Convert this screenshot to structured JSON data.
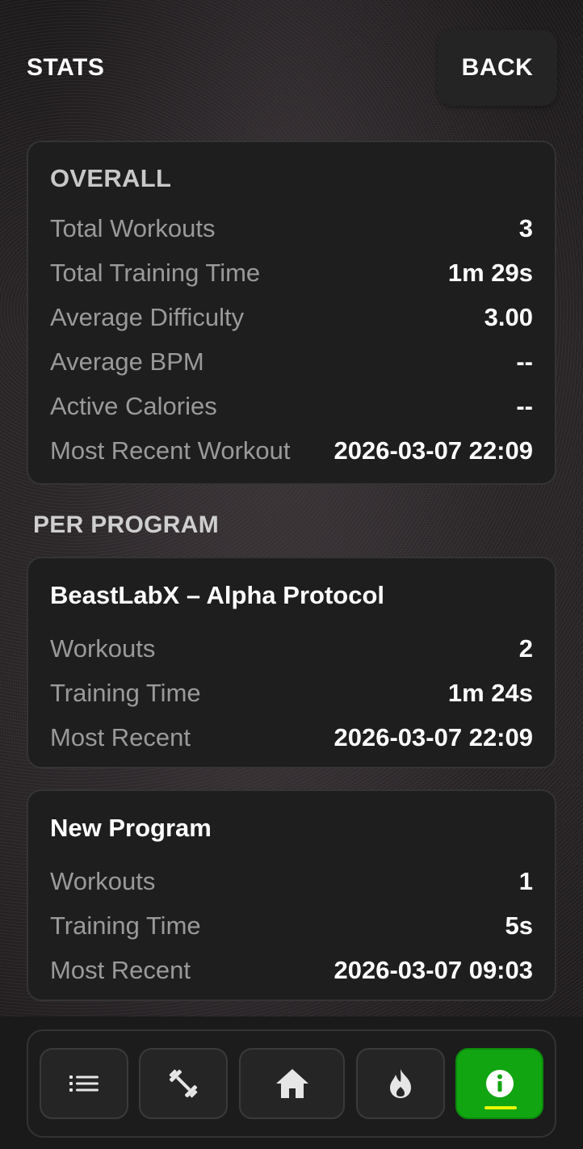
{
  "header": {
    "title": "STATS",
    "back_label": "BACK"
  },
  "overall": {
    "title": "OVERALL",
    "rows": [
      {
        "label": "Total Workouts",
        "value": "3"
      },
      {
        "label": "Total Training Time",
        "value": "1m 29s"
      },
      {
        "label": "Average Difficulty",
        "value": "3.00"
      },
      {
        "label": "Average BPM",
        "value": "--"
      },
      {
        "label": "Active Calories",
        "value": "--"
      },
      {
        "label": "Most Recent Workout",
        "value": "2026-03-07 22:09"
      }
    ]
  },
  "per_program": {
    "section_title": "PER PROGRAM",
    "programs": [
      {
        "name": "BeastLabX – Alpha Protocol",
        "rows": [
          {
            "label": "Workouts",
            "value": "2"
          },
          {
            "label": "Training Time",
            "value": "1m 24s"
          },
          {
            "label": "Most Recent",
            "value": "2026-03-07 22:09"
          }
        ]
      },
      {
        "name": "New Program",
        "rows": [
          {
            "label": "Workouts",
            "value": "1"
          },
          {
            "label": "Training Time",
            "value": "5s"
          },
          {
            "label": "Most Recent",
            "value": "2026-03-07 09:03"
          }
        ]
      }
    ]
  },
  "nav": {
    "items": [
      {
        "icon": "list-icon",
        "active": false
      },
      {
        "icon": "dumbbell-icon",
        "active": false
      },
      {
        "icon": "home-icon",
        "active": false
      },
      {
        "icon": "flame-icon",
        "active": false
      },
      {
        "icon": "info-icon",
        "active": true
      }
    ]
  },
  "colors": {
    "accent_active": "#12a512",
    "active_indicator": "#e8f700",
    "card_background": "#1e1e1e",
    "label_gray": "#9a9a9a"
  }
}
